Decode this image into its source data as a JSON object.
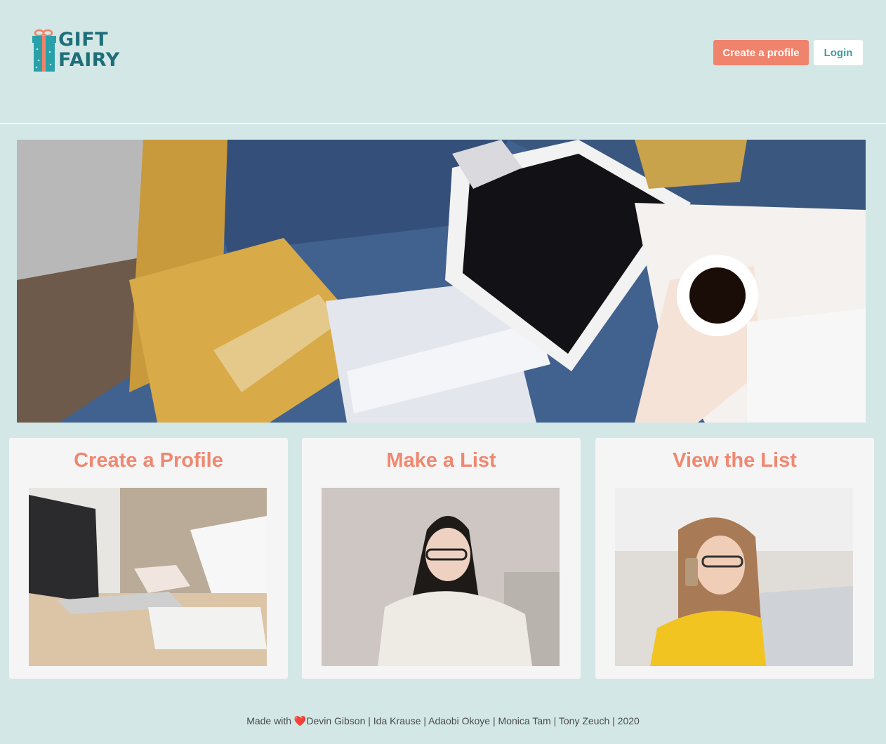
{
  "header": {
    "logo_line1": "GIFT",
    "logo_line2": "FAIRY",
    "create_profile_label": "Create a profile",
    "login_label": "Login"
  },
  "cards": [
    {
      "title": "Create a Profile"
    },
    {
      "title": "Make a List"
    },
    {
      "title": "View the List"
    }
  ],
  "footer": {
    "made_with": "Made with",
    "heart": "❤️",
    "credits": "Devin Gibson | Ida Krause | Adaobi Okoye | Monica Tam | Tony Zeuch | 2020"
  },
  "colors": {
    "background": "#d3e8e6",
    "accent": "#f0836c",
    "logo": "#1f6f7a"
  }
}
